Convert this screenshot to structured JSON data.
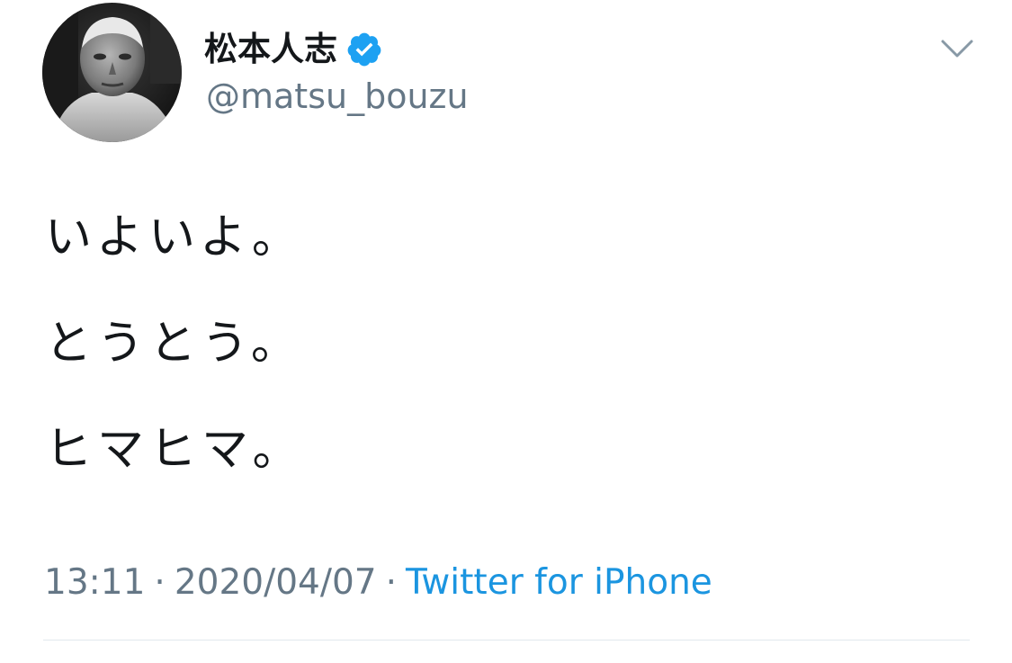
{
  "user": {
    "display_name": "松本人志",
    "handle": "@matsu_bouzu",
    "verified": true
  },
  "tweet": {
    "lines": [
      "いよいよ。",
      "とうとう。",
      "ヒマヒマ。"
    ],
    "time": "13:11",
    "separator": "·",
    "date": "2020/04/07",
    "source": "Twitter for iPhone"
  },
  "icons": {
    "verified": "verified-badge-icon",
    "menu": "chevron-down-icon"
  },
  "colors": {
    "text_primary": "#14171a",
    "text_secondary": "#657786",
    "link": "#1b95e0",
    "verified_badge": "#1da1f2",
    "divider": "#e1e8ed"
  }
}
